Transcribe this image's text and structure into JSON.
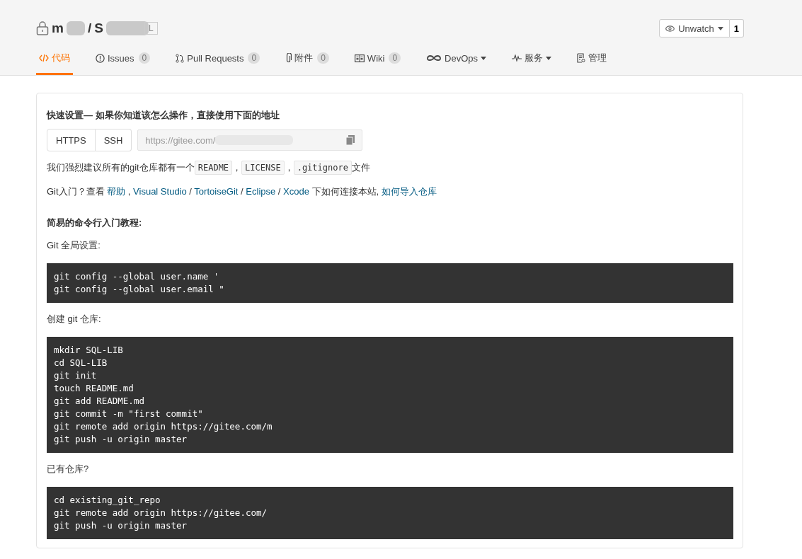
{
  "repo": {
    "owner": "m",
    "separator": "/",
    "name": "S",
    "badge": "L"
  },
  "watch": {
    "label": "Unwatch",
    "count": "1"
  },
  "tabs": [
    {
      "label": "代码",
      "kind": "code",
      "selected": true
    },
    {
      "label": "Issues",
      "kind": "issue",
      "count": "0",
      "selected": false
    },
    {
      "label": "Pull Requests",
      "kind": "pr",
      "count": "0",
      "selected": false
    },
    {
      "label": "附件",
      "kind": "clip",
      "count": "0",
      "selected": false
    },
    {
      "label": "Wiki",
      "kind": "book",
      "count": "0",
      "selected": false
    },
    {
      "label": "DevOps",
      "kind": "infinity",
      "caret": true,
      "selected": false
    },
    {
      "label": "服务",
      "kind": "pulse",
      "caret": true,
      "selected": false
    },
    {
      "label": "管理",
      "kind": "doc",
      "selected": false
    }
  ],
  "quick_setup": {
    "title": "快速设置— 如果你知道该怎么操作，直接使用下面的地址",
    "protocols": [
      {
        "label": "HTTPS",
        "selected": false
      },
      {
        "label": "SSH",
        "selected": false
      }
    ],
    "url": "https://gitee.com/",
    "recommend": [
      {
        "kind": "text",
        "text": "我们强烈建议所有的git仓库都有一个"
      },
      {
        "kind": "code",
        "text": "README"
      },
      {
        "kind": "text",
        "text": "，"
      },
      {
        "kind": "code",
        "text": "LICENSE"
      },
      {
        "kind": "text",
        "text": "，"
      },
      {
        "kind": "code",
        "text": ".gitignore"
      },
      {
        "kind": "text",
        "text": "文件"
      }
    ],
    "help": [
      {
        "kind": "text",
        "text": "Git入门？查看 "
      },
      {
        "kind": "link",
        "text": "帮助"
      },
      {
        "kind": "text",
        "text": " , "
      },
      {
        "kind": "link",
        "text": "Visual Studio"
      },
      {
        "kind": "text",
        "text": " / "
      },
      {
        "kind": "link",
        "text": "TortoiseGit"
      },
      {
        "kind": "text",
        "text": " / "
      },
      {
        "kind": "link",
        "text": "Eclipse"
      },
      {
        "kind": "text",
        "text": " / "
      },
      {
        "kind": "link",
        "text": "Xcode"
      },
      {
        "kind": "text",
        "text": " 下如何连接本站, "
      },
      {
        "kind": "link",
        "text": "如何导入仓库"
      }
    ]
  },
  "tutorial": {
    "title": "简易的命令行入门教程:",
    "sections": [
      {
        "label": "Git 全局设置:",
        "lines": [
          "git config --global user.name '",
          "git config --global user.email \""
        ]
      },
      {
        "label": "创建 git 仓库:",
        "lines": [
          "mkdir SQL-LIB",
          "cd SQL-LIB",
          "git init",
          "touch README.md",
          "git add README.md",
          "git commit -m \"first commit\"",
          "git remote add origin https://gitee.com/m",
          "git push -u origin master"
        ]
      },
      {
        "label": "已有仓库?",
        "lines": [
          "cd existing_git_repo",
          "git remote add origin https://gitee.com/",
          "git push -u origin master"
        ]
      }
    ]
  }
}
